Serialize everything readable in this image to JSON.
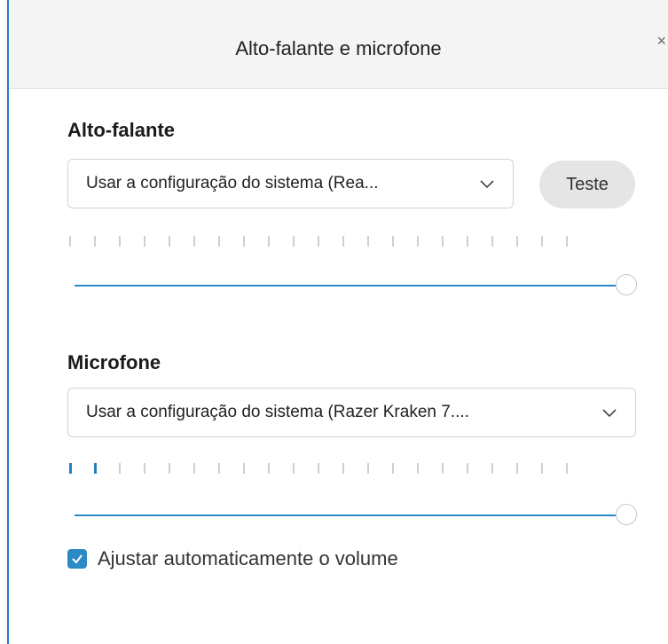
{
  "dialog": {
    "title": "Alto-falante e microfone",
    "close_glyph": "×"
  },
  "speaker": {
    "heading": "Alto-falante",
    "device": "Usar a configuração do sistema (Rea...",
    "test_label": "Teste",
    "meter_level_ticks": 0,
    "meter_total_ticks": 21,
    "volume_percent": 100
  },
  "microphone": {
    "heading": "Microfone",
    "device": "Usar a configuração do sistema (Razer Kraken 7....",
    "meter_level_ticks": 2,
    "meter_total_ticks": 21,
    "volume_percent": 100
  },
  "auto_adjust": {
    "label": "Ajustar automaticamente o volume",
    "checked": true
  },
  "colors": {
    "accent": "#2b89c6",
    "border": "#2f79c9"
  },
  "icons": {
    "close": "close-icon",
    "dropdown": "chevron-down-icon",
    "check": "checkmark-icon"
  }
}
